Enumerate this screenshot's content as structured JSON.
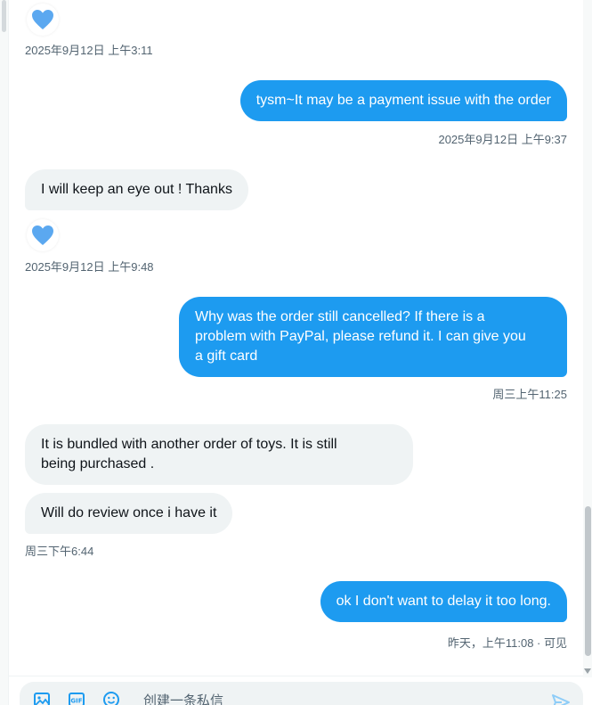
{
  "messages": [
    {
      "id": "m1_reaction",
      "timestamp": "2025年9月12日 上午3:11"
    },
    {
      "id": "m2",
      "text": "tysm~It may be a payment issue with the order",
      "timestamp": "2025年9月12日 上午9:37"
    },
    {
      "id": "m3",
      "text": "I will keep an eye out ! Thanks",
      "timestamp": "2025年9月12日 上午9:48"
    },
    {
      "id": "m4",
      "lines": [
        "Why was the order still cancelled? If there is a",
        "problem with PayPal, please refund it. I can give you",
        "a gift card"
      ],
      "timestamp": "周三上午11:25"
    },
    {
      "id": "m5",
      "lines": [
        "It is bundled with another order of toys. It is still",
        "being purchased ."
      ]
    },
    {
      "id": "m6",
      "text": "Will do review once i have it",
      "timestamp": "周三下午6:44"
    },
    {
      "id": "m7",
      "text": "ok I don't want to delay it too long.",
      "timestamp": "昨天，上午11:08 · 可见"
    }
  ],
  "reaction": {
    "icon": "heart-icon",
    "color": "#5ba8f0"
  },
  "composer": {
    "placeholder": "创建一条私信",
    "icons": [
      "image-icon",
      "gif-icon",
      "emoji-icon",
      "send-icon"
    ]
  },
  "colors": {
    "accent": "#1d9bf0",
    "incoming_bubble": "#eff3f4",
    "muted_text": "#536471"
  }
}
